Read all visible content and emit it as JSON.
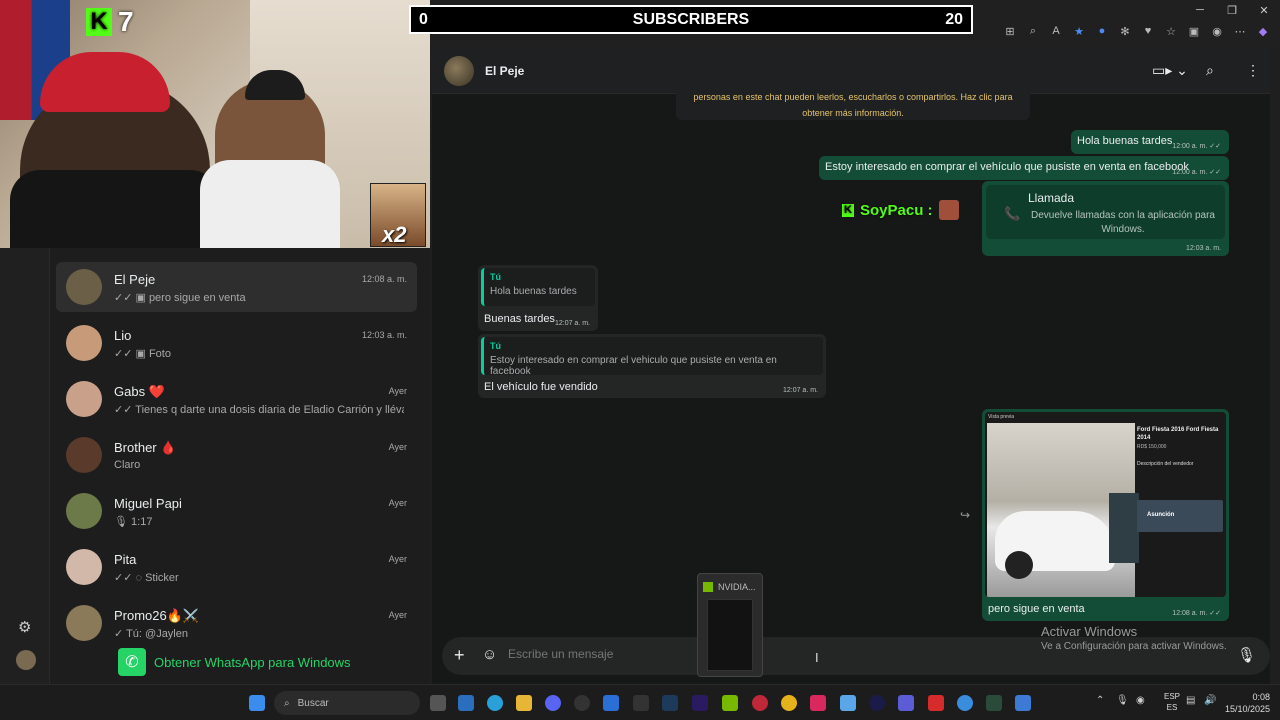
{
  "stream_overlay": {
    "kick_count": "7",
    "subs_left": "0",
    "subs_label": "SUBSCRIBERS",
    "subs_right": "20",
    "meme_badge": "x2",
    "chat_user": "SoyPacu :"
  },
  "chat_list": [
    {
      "name": "El Peje",
      "time": "12:08 a. m.",
      "preview": "✓✓ ▣ pero sigue en venta",
      "avatar": "#6b5f48",
      "active": true
    },
    {
      "name": "Lio",
      "time": "12:03 a. m.",
      "preview": "✓✓ ▣ Foto",
      "avatar": "#c79b7a"
    },
    {
      "name": "Gabs ❤️",
      "time": "Ayer",
      "preview": "✓✓ Tienes q darte una dosis diaria de Eladio Carrión y llévate d...",
      "avatar": "#c9a08a"
    },
    {
      "name": "Brother 🩸",
      "time": "Ayer",
      "preview": "Claro",
      "avatar": "#5a3a2a"
    },
    {
      "name": "Miguel Papi",
      "time": "Ayer",
      "preview": "🎙 1:17",
      "avatar": "#6c7a4a"
    },
    {
      "name": "Pita",
      "time": "Ayer",
      "preview": "✓✓ ◌ Sticker",
      "avatar": "#d2b8a8"
    },
    {
      "name": "Promo26🔥⚔️",
      "time": "Ayer",
      "preview": "✓ Tú: @Jaylen",
      "avatar": "#8a7a5a"
    }
  ],
  "get_whatsapp": "Obtener WhatsApp para Windows",
  "conversation": {
    "contact_name": "El Peje",
    "encryption_notice_line1": "personas en este chat pueden leerlos, escucharlos o compartirlos. Haz clic para",
    "encryption_notice_line2": "obtener más información.",
    "msg1": {
      "text": "Hola buenas tardes",
      "time": "12:00 a. m. ✓✓"
    },
    "msg2": {
      "text": "Estoy interesado en comprar el vehículo que pusiste en venta en facebook",
      "time": "12:00 a. m. ✓✓"
    },
    "call": {
      "title": "Llamada",
      "subtitle": "Devuelve llamadas con la aplicación para Windows.",
      "time": "12:03 a. m."
    },
    "reply1": {
      "quote_author": "Tú",
      "quote_text": "Hola buenas tardes",
      "text": "Buenas tardes",
      "time": "12:07 a. m."
    },
    "reply2": {
      "quote_author": "Tú",
      "quote_text": "Estoy interesado en comprar el vehiculo que pusiste en venta en facebook",
      "text": "El vehículo fue vendido",
      "time": "12:07 a. m."
    },
    "image_msg": {
      "caption": "pero sigue en venta",
      "time": "12:08 a. m. ✓✓",
      "listing_title": "Ford Fiesta 2016 Ford Fiesta 2014",
      "listing_price": "RD$ 150,000",
      "listing_header": "Vista previa",
      "listing_section": "Descripción del vendedor",
      "listing_map": "Asunción"
    }
  },
  "composer": {
    "placeholder": "Escribe un mensaje"
  },
  "activation": {
    "line1": "Activar Windows",
    "line2": "Ve a Configuración para activar Windows."
  },
  "nvidia_popup": "NVIDIA...",
  "taskbar": {
    "search": "Buscar",
    "lang1": "ESP",
    "lang2": "ES",
    "time": "0:08",
    "date": "15/10/2025"
  }
}
